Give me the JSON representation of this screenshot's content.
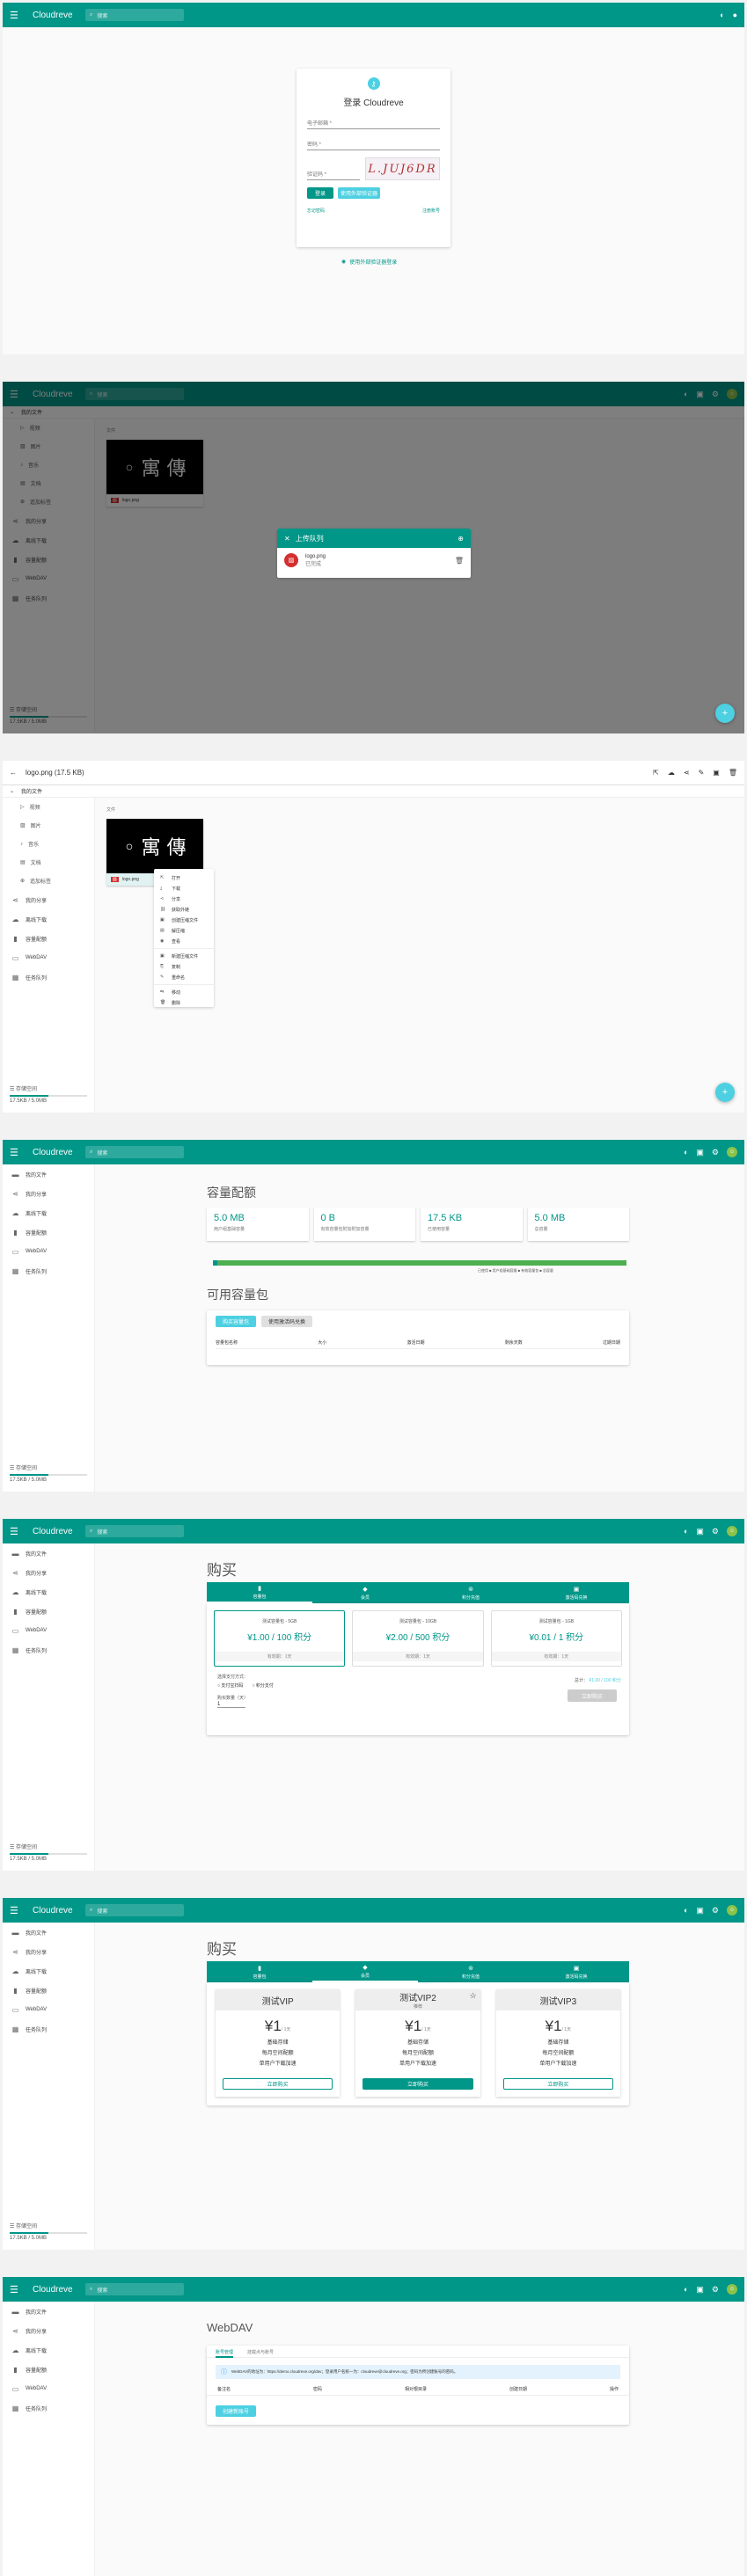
{
  "app": {
    "title": "Cloudreve",
    "search_placeholder": "搜索"
  },
  "login": {
    "title": "登录 Cloudreve",
    "email_label": "电子邮箱 *",
    "password_label": "密码 *",
    "captcha_label": "验证码 *",
    "login_button": "登录",
    "external_login_button": "使用外部验证器",
    "forgot_link": "忘记密码",
    "register_link": "注册账号",
    "passwordless_link": "使用外部验证器登录",
    "captcha_text": "L.JUJ6DR"
  },
  "sidebar": {
    "my_files": "我的文件",
    "video": "视频",
    "image": "图片",
    "music": "音乐",
    "document": "文档",
    "tags": "追加标签",
    "my_share": "我的分享",
    "offline": "离线下载",
    "storage": "容量配额",
    "webdav": "WebDAV",
    "tasks": "任务队列",
    "storage_footer": "存储空间",
    "storage_used": "17.5KB / 5.0MB"
  },
  "explorer": {
    "breadcrumb": "我的文件",
    "section_label": "文件",
    "file_name": "logo.png"
  },
  "upload": {
    "title": "上传队列",
    "file_name": "logo.png",
    "status": "已完成"
  },
  "preview": {
    "title": "logo.png (17.5 KB)"
  },
  "context_menu": {
    "items": [
      "打开",
      "下载",
      "分享",
      "获取外链",
      "创建压缩文件",
      "解压缩",
      "查看",
      "新建压缩文件",
      "复制",
      "重命名",
      "移动",
      "删除"
    ]
  },
  "quota": {
    "title": "容量配额",
    "stats": [
      {
        "value": "5.0 MB",
        "label": "用户组基础容量"
      },
      {
        "value": "0 B",
        "label": "有效容量包附加附加容量"
      },
      {
        "value": "17.5 KB",
        "label": "已使用容量"
      },
      {
        "value": "5.0 MB",
        "label": "总容量"
      }
    ],
    "legend": "已使用 ■ 用户组基础容量 ■ 有效容量包 ■ 总容量",
    "packs_title": "可用容量包",
    "buy_button": "购买容量包",
    "redeem_button": "使用激活码兑换",
    "columns": [
      "容量包名称",
      "大小",
      "激活日期",
      "剩余天数",
      "过期日期"
    ]
  },
  "purchase": {
    "title": "购买",
    "tabs": [
      "容量包",
      "会员",
      "积分充值",
      "激活码兑换"
    ],
    "packs": [
      {
        "name": "测试容量包 - 5GB",
        "price": "¥1.00 / 100 积分",
        "duration": "有效期：1天"
      },
      {
        "name": "测试容量包 - 10GB",
        "price": "¥2.00 / 500 积分",
        "duration": "有效期：1天"
      },
      {
        "name": "测试容量包 - 1GB",
        "price": "¥0.01 / 1 积分",
        "duration": "有效期：1天"
      }
    ],
    "payment_label": "选择支付方式：",
    "pay_alipay": "支付宝扫码",
    "pay_points": "积分支付",
    "qty_label": "购买数量（天）",
    "qty_value": "1",
    "total_label": "总计：",
    "pay_button": "立即购买"
  },
  "membership": {
    "plans": [
      {
        "name": "测试VIP",
        "sub": "",
        "price": "¥1",
        "unit": "/ 1天",
        "features": [
          "基础存储",
          "每月空间配额",
          "单用户下载加速"
        ],
        "button": "立即购买"
      },
      {
        "name": "测试VIP2",
        "sub": "推荐",
        "price": "¥1",
        "unit": "/ 1天",
        "features": [
          "基础存储",
          "每月空间配额",
          "单用户下载加速"
        ],
        "button": "立即购买"
      },
      {
        "name": "测试VIP3",
        "sub": "",
        "price": "¥1",
        "unit": "/ 1天",
        "features": [
          "基础存储",
          "每月空间配额",
          "单用户下载加速"
        ],
        "button": "立即购买"
      }
    ]
  },
  "webdav": {
    "title": "WebDAV",
    "tabs": [
      "账号管理",
      "挂载点与账号"
    ],
    "info": "WebDAV的地址为：https://demo.cloudreve.org/dav；登录用户名统一为：cloudreve@cloudreve.org；密码为所创建账号的密码。",
    "columns": [
      "备注名",
      "密码",
      "相对根目录",
      "创建日期",
      "操作"
    ],
    "create_button": "创建新账号"
  },
  "colors": {
    "primary": "#009688",
    "accent": "#4dd0e1"
  }
}
